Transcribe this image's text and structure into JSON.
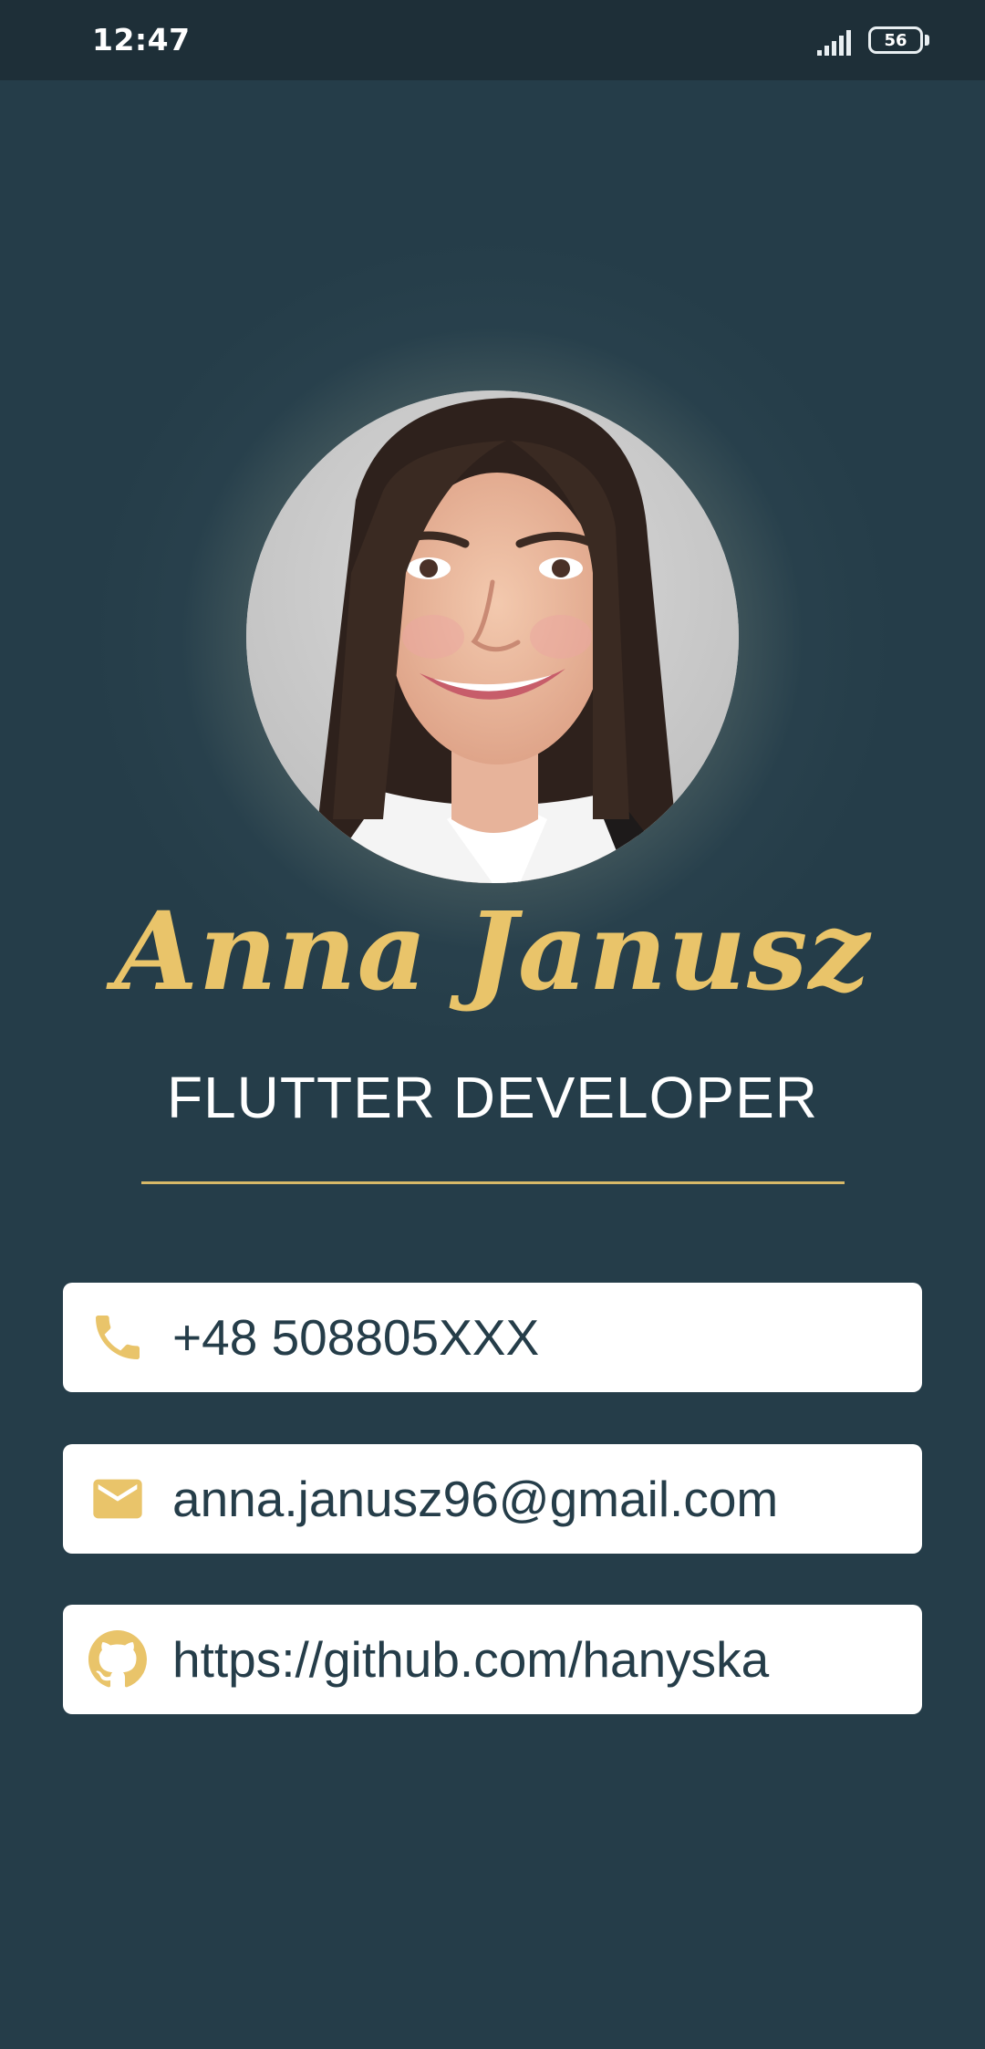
{
  "status_bar": {
    "time": "12:47",
    "battery_level": "56",
    "icons": [
      "signal-icon",
      "battery-icon"
    ]
  },
  "profile": {
    "name": "Anna Janusz",
    "title": "FLUTTER DEVELOPER",
    "avatar": "profile-photo"
  },
  "contacts": [
    {
      "icon": "phone-icon",
      "value": "+48 508805XXX"
    },
    {
      "icon": "email-icon",
      "value": "anna.janusz96@gmail.com"
    },
    {
      "icon": "github-icon",
      "value": "https://github.com/hanyska"
    }
  ],
  "colors": {
    "background": "#253d49",
    "status_bar": "#1e2f38",
    "accent": "#e9c46a",
    "card": "#ffffff",
    "card_text": "#253d49"
  }
}
